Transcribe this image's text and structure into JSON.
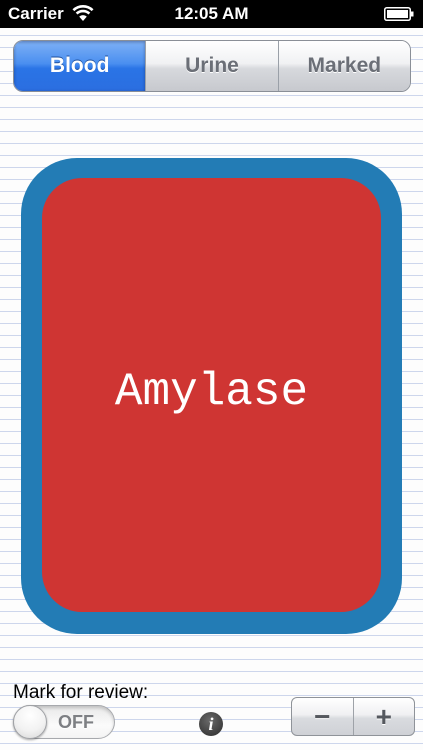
{
  "status_bar": {
    "carrier": "Carrier",
    "time": "12:05 AM"
  },
  "segments": {
    "items": [
      "Blood",
      "Urine",
      "Marked"
    ],
    "selected": "Blood"
  },
  "card": {
    "title": "Amylase",
    "border_color": "#237cb5",
    "fill_color": "#cf3533"
  },
  "review": {
    "label": "Mark for review:",
    "toggle_text": "OFF"
  },
  "icons": {
    "wifi": "wifi-icon",
    "battery": "battery-icon",
    "info": "info-icon"
  },
  "stepper": {
    "minus": "−",
    "plus": "+"
  }
}
